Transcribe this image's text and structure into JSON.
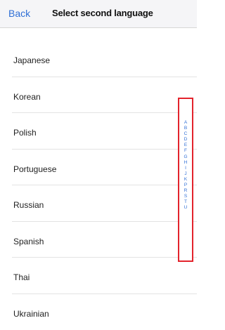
{
  "nav": {
    "back_label": "Back",
    "title": "Select second language"
  },
  "languages": [
    "Japanese",
    "Korean",
    "Polish",
    "Portuguese",
    "Russian",
    "Spanish",
    "Thai",
    "Ukrainian"
  ],
  "index_letters": [
    "A",
    "B",
    "C",
    "D",
    "E",
    "F",
    "G",
    "H",
    "I",
    "J",
    "K",
    "P",
    "R",
    "S",
    "T",
    "U"
  ],
  "colors": {
    "accent": "#2f6fd6",
    "highlight_border": "#e3232c"
  }
}
